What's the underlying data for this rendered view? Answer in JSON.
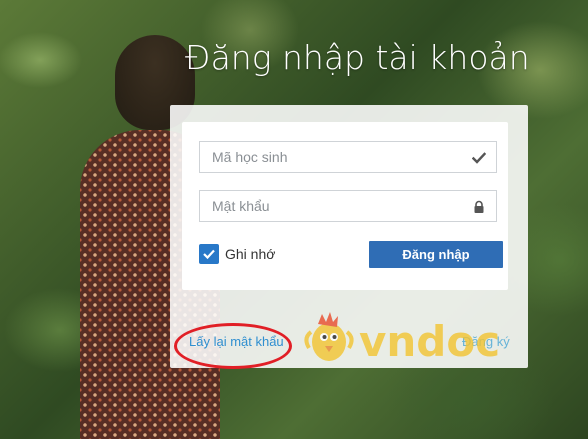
{
  "header": {
    "title": "Đăng nhập tài khoản"
  },
  "form": {
    "student_id_placeholder": "Mã học sinh",
    "password_placeholder": "Mật khẩu",
    "remember_label": "Ghi nhớ",
    "remember_checked": true,
    "login_label": "Đăng nhập"
  },
  "links": {
    "forgot_password": "Lấy lại mật khẩu",
    "register": "Đăng ký"
  },
  "watermark": {
    "text": "vndoc"
  },
  "colors": {
    "accent": "#2f6db5",
    "link": "#2f8fd0",
    "highlight": "#e11f26",
    "watermark": "#f2c430"
  },
  "icons": {
    "student_field": "check-icon",
    "password_field": "lock-icon",
    "checkbox": "checkmark-icon"
  }
}
